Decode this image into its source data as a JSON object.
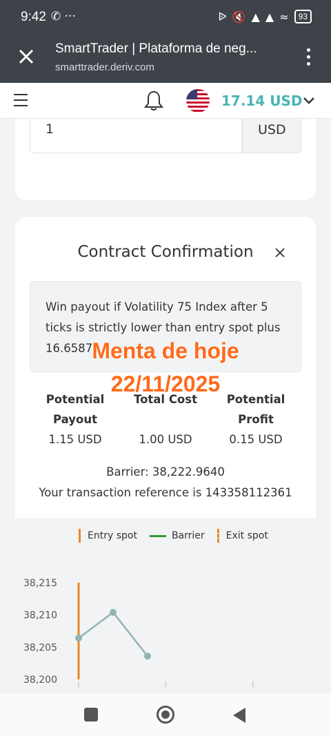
{
  "status_bar": {
    "time": "9:42",
    "left_icons": [
      "whatsapp-icon",
      "more-dots-icon"
    ],
    "right_icons": [
      "bluetooth-icon",
      "mute-icon",
      "signal-icon",
      "signal-3g-icon",
      "wifi-icon"
    ],
    "battery": "93"
  },
  "tab": {
    "title": "SmartTrader | Plataforma de neg...",
    "url": "smarttrader.deriv.com"
  },
  "header": {
    "balance": "17.14 USD"
  },
  "stake": {
    "value": "1",
    "currency": "USD"
  },
  "confirmation": {
    "title": "Contract Confirmation",
    "description": "Win payout if Volatility 75 Index after 5 ticks is strictly lower than entry spot plus 16.6587.",
    "metrics": [
      {
        "label": "Potential Payout",
        "value": "1.15 USD"
      },
      {
        "label": "Total Cost",
        "value": "1.00 USD"
      },
      {
        "label": "Potential Profit",
        "value": "0.15 USD"
      }
    ],
    "barrier": "Barrier: 38,222.9640",
    "reference": "Your transaction reference is 143358112361"
  },
  "overlay": {
    "line1": "Menta de hoje",
    "line2": "22/11/2025"
  },
  "chart_data": {
    "type": "line",
    "legend": [
      "Entry spot",
      "Barrier",
      "Exit spot"
    ],
    "colors": {
      "entry_spot": "#e88924",
      "barrier": "#2e9a3a",
      "exit_spot": "#e88924",
      "line": "#8fb5b3"
    },
    "y_ticks": [
      "38,215",
      "38,210",
      "38,205",
      "38,200"
    ],
    "ylim": [
      38200,
      38215
    ],
    "points": [
      {
        "tick": 1,
        "value": 38206.4
      },
      {
        "tick": 2,
        "value": 38210.4
      },
      {
        "tick": 3,
        "value": 38203.6
      }
    ],
    "entry_tick": 1,
    "grid": false,
    "legend_position": "top"
  }
}
